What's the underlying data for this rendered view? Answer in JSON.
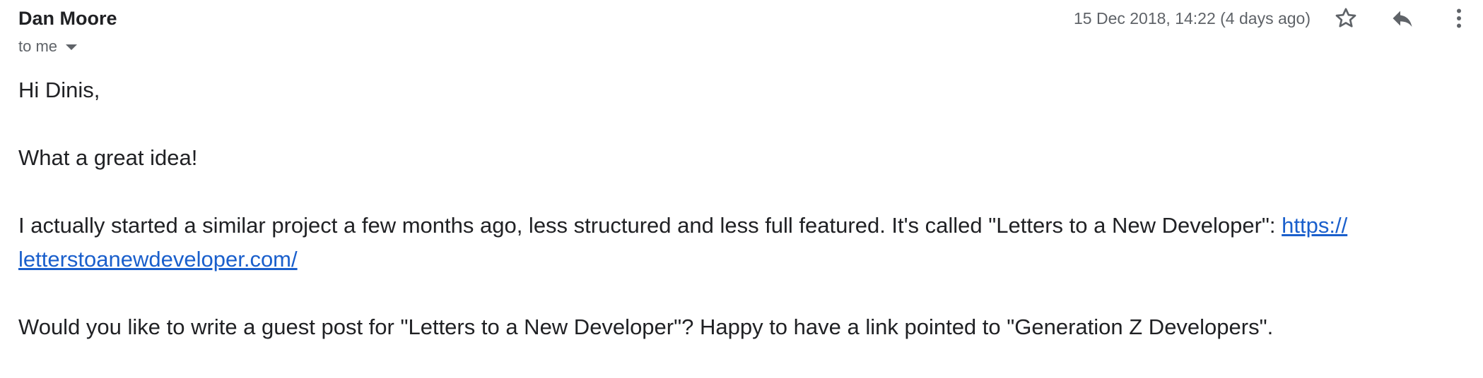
{
  "email": {
    "sender": "Dan Moore",
    "recipient_label": "to me",
    "date": "15 Dec 2018, 14:22 (4 days ago)",
    "icons": {
      "star": "star-icon",
      "reply": "reply-icon",
      "more": "more-vertical-icon"
    },
    "body": {
      "greeting": "Hi Dinis,",
      "line1": "What a great idea!",
      "line2_text": "I actually started a similar project a few months ago, less structured and less full featured. It's called \"Letters to a New Developer\": ",
      "line2_link_part1": "https://",
      "line2_link_part2": "letterstoanewdeveloper.com/",
      "line3": "Would you like to write a guest post for \"Letters to a New Developer\"? Happy to have a link pointed to \"Generation Z Developers\"."
    }
  },
  "colors": {
    "text": "#202124",
    "secondary_text": "#5f6368",
    "link": "#1a5fcc"
  }
}
